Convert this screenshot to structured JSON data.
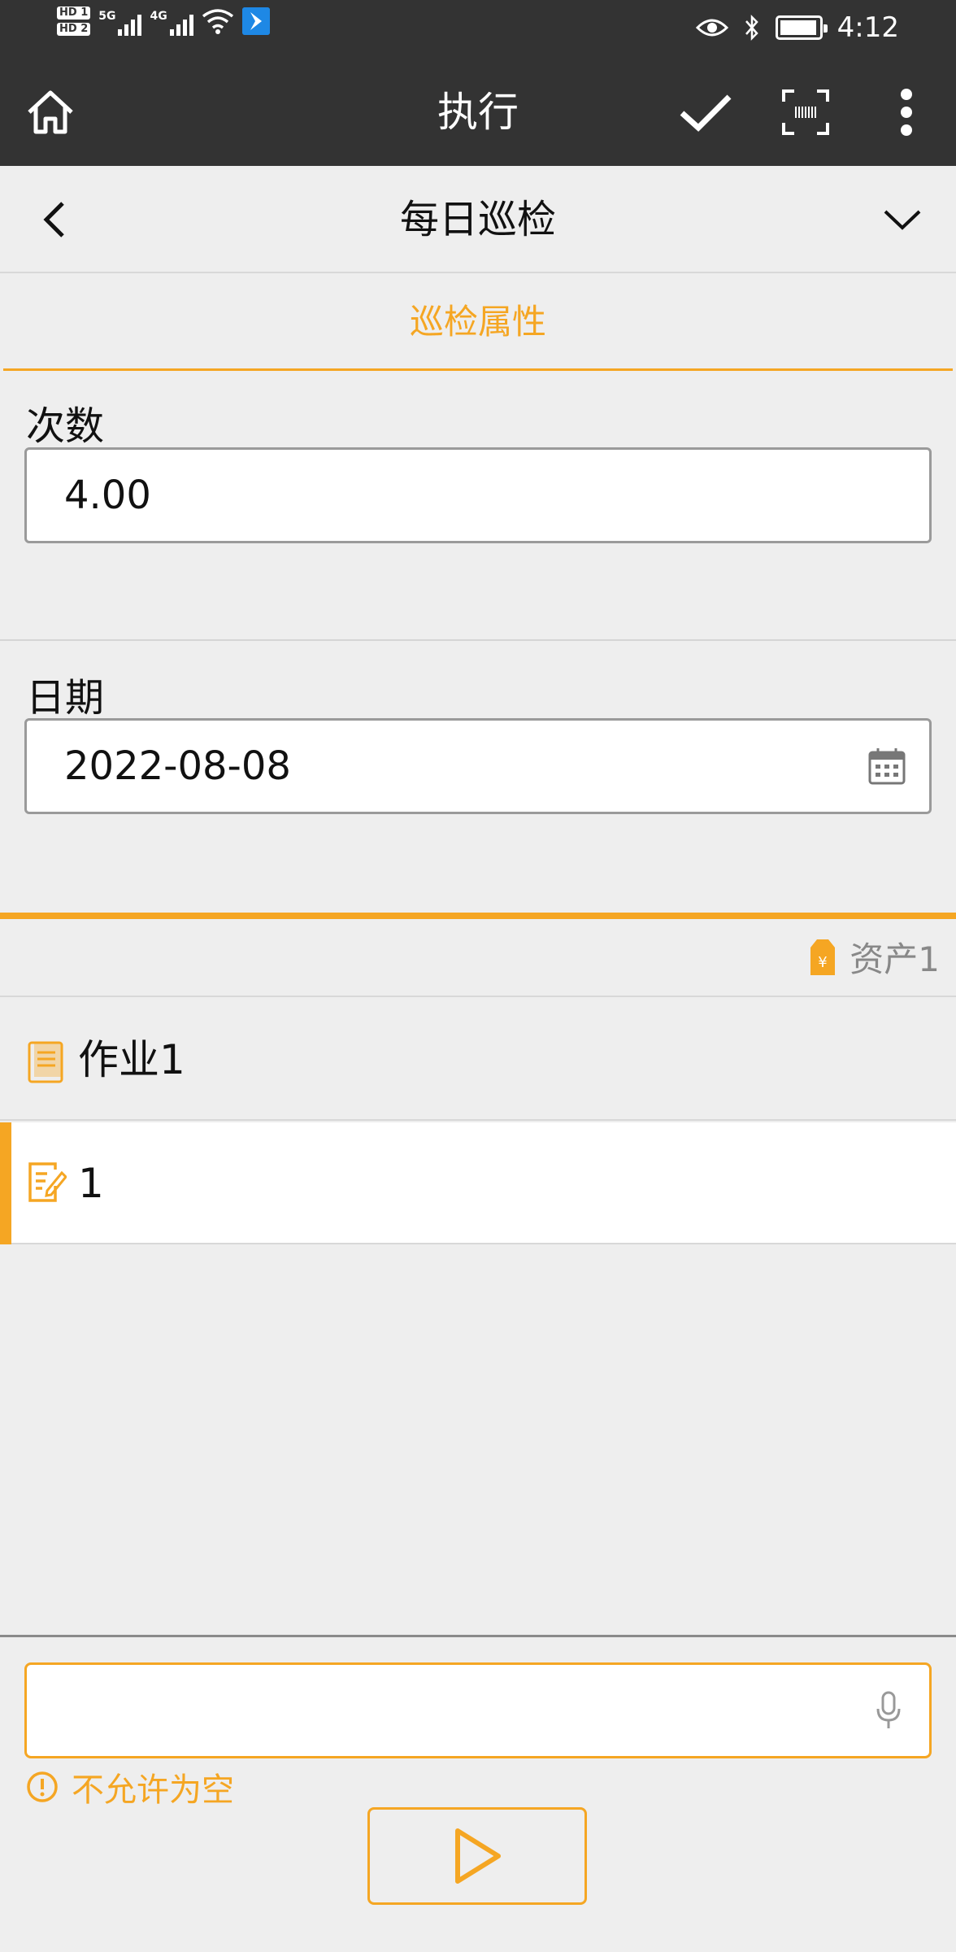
{
  "status_bar": {
    "sim1": "HD 1",
    "sim2": "HD 2",
    "network1": "5G",
    "network2": "4G",
    "time": "4:12"
  },
  "app_bar": {
    "title": "执行",
    "icons": [
      "home-icon",
      "check-icon",
      "scan-icon",
      "more-vertical-icon"
    ]
  },
  "header": {
    "title": "每日巡检",
    "icons": [
      "back-icon",
      "chevron-down-icon"
    ]
  },
  "section": {
    "tab_label": "巡检属性"
  },
  "fields": {
    "count_label": "次数",
    "count_value": "4.00",
    "date_label": "日期",
    "date_value": "2022-08-08"
  },
  "asset": {
    "label": "资产1",
    "icon": "price-tag-icon"
  },
  "job": {
    "label": "作业1",
    "icon": "document-icon"
  },
  "item": {
    "label": "1",
    "icon": "edit-note-icon"
  },
  "answer_input": {
    "value": "",
    "placeholder": ""
  },
  "validation": {
    "message": "不允许为空"
  },
  "colors": {
    "accent": "#f5a623",
    "bar": "#333333",
    "background": "#eeeeee"
  }
}
